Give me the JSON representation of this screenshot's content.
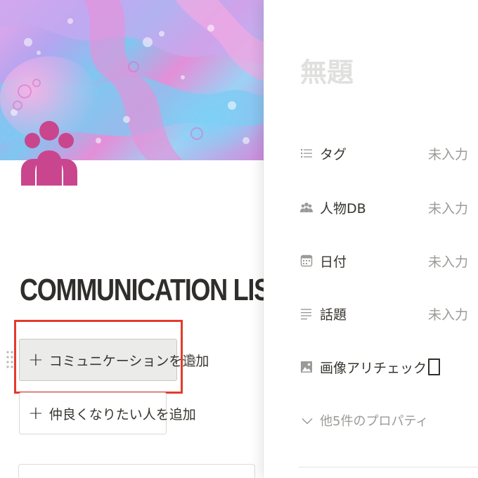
{
  "page": {
    "title": "COMMUNICATION LIS"
  },
  "actions": {
    "add_communication_label": "コミュニケーションを追加",
    "add_person_label": "仲良くなりたい人を追加"
  },
  "peek": {
    "title_placeholder": "無題",
    "properties": [
      {
        "name": "タグ",
        "icon": "list-icon",
        "value": "未入力"
      },
      {
        "name": "人物DB",
        "icon": "people-icon",
        "value": "未入力"
      },
      {
        "name": "日付",
        "icon": "calendar-icon",
        "value": "未入力"
      },
      {
        "name": "話題",
        "icon": "text-lines-icon",
        "value": "未入力"
      },
      {
        "name": "画像アリチェック",
        "icon": "image-icon",
        "checked": false
      }
    ],
    "more_properties_label": "他5件のプロパティ"
  },
  "colors": {
    "accent_highlight": "#e23b2e",
    "page_icon": "#c9468f",
    "muted_text": "#9b9a97"
  }
}
